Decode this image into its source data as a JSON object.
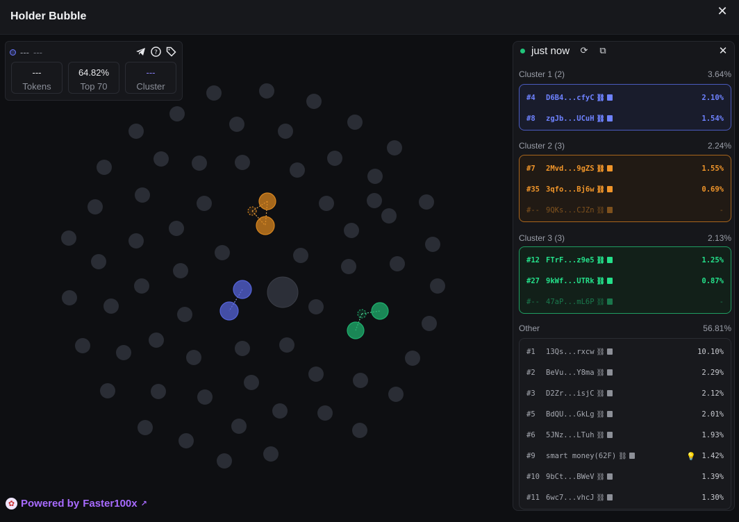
{
  "window": {
    "title": "Holder Bubble"
  },
  "stats": {
    "header_primary": "---",
    "header_secondary": "---",
    "cards": [
      {
        "value": "---",
        "label": "Tokens"
      },
      {
        "value": "64.82%",
        "label": "Top 70"
      },
      {
        "value": "---",
        "label": "Cluster"
      }
    ]
  },
  "panel": {
    "status": "just now",
    "groups": [
      {
        "name": "Cluster 1 (2)",
        "pct": "3.64%",
        "color": "#6e82ff",
        "rows": [
          {
            "rank": "#4",
            "addr": "D6B4...cfyC",
            "pct": "2.10%"
          },
          {
            "rank": "#8",
            "addr": "zgJb...UCuH",
            "pct": "1.54%"
          }
        ]
      },
      {
        "name": "Cluster 2 (3)",
        "pct": "2.24%",
        "color": "#f0952a",
        "rows": [
          {
            "rank": "#7",
            "addr": "2Mvd...9gZS",
            "pct": "1.55%"
          },
          {
            "rank": "#35",
            "addr": "3qfo...Bj6w",
            "pct": "0.69%"
          },
          {
            "rank": "#--",
            "addr": "9QKs...CJZn",
            "pct": "-"
          }
        ]
      },
      {
        "name": "Cluster 3 (3)",
        "pct": "2.13%",
        "color": "#24e08a",
        "rows": [
          {
            "rank": "#12",
            "addr": "FTrF...z9e5",
            "pct": "1.25%"
          },
          {
            "rank": "#27",
            "addr": "9kWf...UTRk",
            "pct": "0.87%"
          },
          {
            "rank": "#--",
            "addr": "47aP...mL6P",
            "pct": "-"
          }
        ]
      },
      {
        "name": "Other",
        "pct": "56.81%",
        "color": "#a6a9b1",
        "rows": [
          {
            "rank": "#1",
            "addr": "13Qs...rxcw",
            "pct": "10.10%"
          },
          {
            "rank": "#2",
            "addr": "BeVu...Y8ma",
            "pct": "2.29%"
          },
          {
            "rank": "#3",
            "addr": "D2Zr...isjC",
            "pct": "2.12%"
          },
          {
            "rank": "#5",
            "addr": "BdQU...GkLg",
            "pct": "2.01%"
          },
          {
            "rank": "#6",
            "addr": "5JNz...LTuh",
            "pct": "1.93%"
          },
          {
            "rank": "#9",
            "addr": "smart money(62F)",
            "pct": "1.42%",
            "icon": "lightbulb-icon"
          },
          {
            "rank": "#10",
            "addr": "9bCt...BWeV",
            "pct": "1.39%"
          },
          {
            "rank": "#11",
            "addr": "6wc7...vhcJ",
            "pct": "1.30%"
          }
        ]
      }
    ]
  },
  "footer": {
    "powered_by": "Powered by ",
    "brand": "Faster100x"
  },
  "colors": {
    "bubble": "#2a2d35",
    "cluster1": "#5564d8",
    "cluster2": "#d8861f",
    "cluster3": "#1fb06e",
    "accent": "#a86bff"
  }
}
